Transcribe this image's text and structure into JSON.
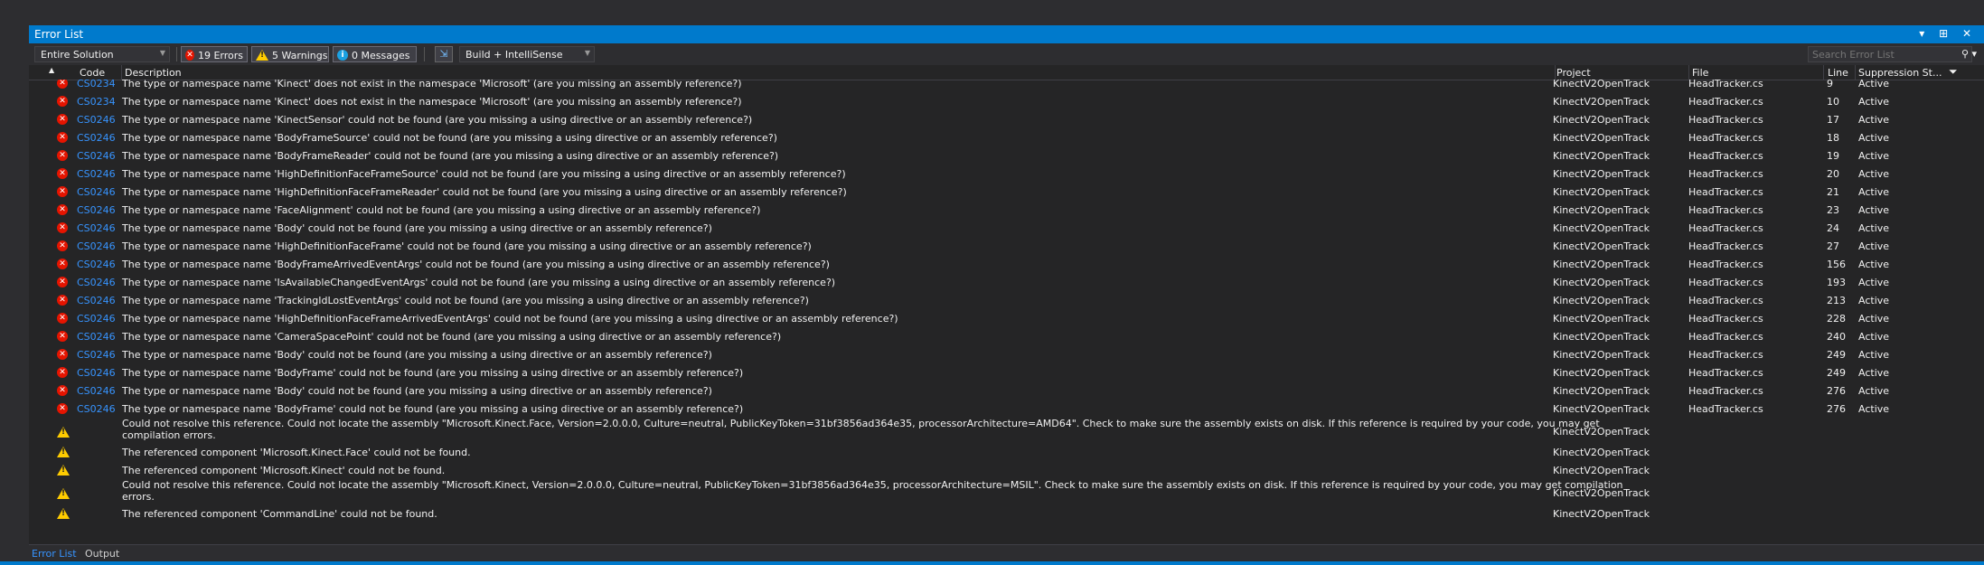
{
  "panel": {
    "title": "Error List",
    "window_buttons": "▾ ⊞ ✕"
  },
  "toolbar": {
    "scope": "Entire Solution",
    "errors": "19 Errors",
    "warnings": "5 Warnings",
    "messages": "0 Messages",
    "build_filter": "Build + IntelliSense",
    "search_placeholder": "Search Error List"
  },
  "columns": {
    "code": "Code",
    "description": "Description",
    "project": "Project",
    "file": "File",
    "line": "Line",
    "suppression": "Suppression St..."
  },
  "rows": [
    {
      "type": "error",
      "code": "CS0234",
      "desc": "The type or namespace name 'Kinect' does not exist in the namespace 'Microsoft' (are you missing an assembly reference?)",
      "project": "KinectV2OpenTrack",
      "file": "HeadTracker.cs",
      "line": "9",
      "state": "Active"
    },
    {
      "type": "error",
      "code": "CS0234",
      "desc": "The type or namespace name 'Kinect' does not exist in the namespace 'Microsoft' (are you missing an assembly reference?)",
      "project": "KinectV2OpenTrack",
      "file": "HeadTracker.cs",
      "line": "10",
      "state": "Active"
    },
    {
      "type": "error",
      "code": "CS0246",
      "desc": "The type or namespace name 'KinectSensor' could not be found (are you missing a using directive or an assembly reference?)",
      "project": "KinectV2OpenTrack",
      "file": "HeadTracker.cs",
      "line": "17",
      "state": "Active"
    },
    {
      "type": "error",
      "code": "CS0246",
      "desc": "The type or namespace name 'BodyFrameSource' could not be found (are you missing a using directive or an assembly reference?)",
      "project": "KinectV2OpenTrack",
      "file": "HeadTracker.cs",
      "line": "18",
      "state": "Active"
    },
    {
      "type": "error",
      "code": "CS0246",
      "desc": "The type or namespace name 'BodyFrameReader' could not be found (are you missing a using directive or an assembly reference?)",
      "project": "KinectV2OpenTrack",
      "file": "HeadTracker.cs",
      "line": "19",
      "state": "Active"
    },
    {
      "type": "error",
      "code": "CS0246",
      "desc": "The type or namespace name 'HighDefinitionFaceFrameSource' could not be found (are you missing a using directive or an assembly reference?)",
      "project": "KinectV2OpenTrack",
      "file": "HeadTracker.cs",
      "line": "20",
      "state": "Active"
    },
    {
      "type": "error",
      "code": "CS0246",
      "desc": "The type or namespace name 'HighDefinitionFaceFrameReader' could not be found (are you missing a using directive or an assembly reference?)",
      "project": "KinectV2OpenTrack",
      "file": "HeadTracker.cs",
      "line": "21",
      "state": "Active"
    },
    {
      "type": "error",
      "code": "CS0246",
      "desc": "The type or namespace name 'FaceAlignment' could not be found (are you missing a using directive or an assembly reference?)",
      "project": "KinectV2OpenTrack",
      "file": "HeadTracker.cs",
      "line": "23",
      "state": "Active"
    },
    {
      "type": "error",
      "code": "CS0246",
      "desc": "The type or namespace name 'Body' could not be found (are you missing a using directive or an assembly reference?)",
      "project": "KinectV2OpenTrack",
      "file": "HeadTracker.cs",
      "line": "24",
      "state": "Active"
    },
    {
      "type": "error",
      "code": "CS0246",
      "desc": "The type or namespace name 'HighDefinitionFaceFrame' could not be found (are you missing a using directive or an assembly reference?)",
      "project": "KinectV2OpenTrack",
      "file": "HeadTracker.cs",
      "line": "27",
      "state": "Active"
    },
    {
      "type": "error",
      "code": "CS0246",
      "desc": "The type or namespace name 'BodyFrameArrivedEventArgs' could not be found (are you missing a using directive or an assembly reference?)",
      "project": "KinectV2OpenTrack",
      "file": "HeadTracker.cs",
      "line": "156",
      "state": "Active"
    },
    {
      "type": "error",
      "code": "CS0246",
      "desc": "The type or namespace name 'IsAvailableChangedEventArgs' could not be found (are you missing a using directive or an assembly reference?)",
      "project": "KinectV2OpenTrack",
      "file": "HeadTracker.cs",
      "line": "193",
      "state": "Active"
    },
    {
      "type": "error",
      "code": "CS0246",
      "desc": "The type or namespace name 'TrackingIdLostEventArgs' could not be found (are you missing a using directive or an assembly reference?)",
      "project": "KinectV2OpenTrack",
      "file": "HeadTracker.cs",
      "line": "213",
      "state": "Active"
    },
    {
      "type": "error",
      "code": "CS0246",
      "desc": "The type or namespace name 'HighDefinitionFaceFrameArrivedEventArgs' could not be found (are you missing a using directive or an assembly reference?)",
      "project": "KinectV2OpenTrack",
      "file": "HeadTracker.cs",
      "line": "228",
      "state": "Active"
    },
    {
      "type": "error",
      "code": "CS0246",
      "desc": "The type or namespace name 'CameraSpacePoint' could not be found (are you missing a using directive or an assembly reference?)",
      "project": "KinectV2OpenTrack",
      "file": "HeadTracker.cs",
      "line": "240",
      "state": "Active"
    },
    {
      "type": "error",
      "code": "CS0246",
      "desc": "The type or namespace name 'Body' could not be found (are you missing a using directive or an assembly reference?)",
      "project": "KinectV2OpenTrack",
      "file": "HeadTracker.cs",
      "line": "249",
      "state": "Active"
    },
    {
      "type": "error",
      "code": "CS0246",
      "desc": "The type or namespace name 'BodyFrame' could not be found (are you missing a using directive or an assembly reference?)",
      "project": "KinectV2OpenTrack",
      "file": "HeadTracker.cs",
      "line": "249",
      "state": "Active"
    },
    {
      "type": "error",
      "code": "CS0246",
      "desc": "The type or namespace name 'Body' could not be found (are you missing a using directive or an assembly reference?)",
      "project": "KinectV2OpenTrack",
      "file": "HeadTracker.cs",
      "line": "276",
      "state": "Active"
    },
    {
      "type": "error",
      "code": "CS0246",
      "desc": "The type or namespace name 'BodyFrame' could not be found (are you missing a using directive or an assembly reference?)",
      "project": "KinectV2OpenTrack",
      "file": "HeadTracker.cs",
      "line": "276",
      "state": "Active"
    },
    {
      "type": "warning",
      "code": "",
      "desc": "Could not resolve this reference. Could not locate the assembly \"Microsoft.Kinect.Face, Version=2.0.0.0, Culture=neutral, PublicKeyToken=31bf3856ad364e35, processorArchitecture=AMD64\". Check to make sure the assembly exists on disk. If this reference is required by your code, you may get",
      "desc2": "compilation errors.",
      "project": "KinectV2OpenTrack",
      "file": "",
      "line": "",
      "state": ""
    },
    {
      "type": "warning",
      "code": "",
      "desc": "The referenced component 'Microsoft.Kinect.Face' could not be found.",
      "project": "KinectV2OpenTrack",
      "file": "",
      "line": "",
      "state": ""
    },
    {
      "type": "warning",
      "code": "",
      "desc": "The referenced component 'Microsoft.Kinect' could not be found.",
      "project": "KinectV2OpenTrack",
      "file": "",
      "line": "",
      "state": ""
    },
    {
      "type": "warning",
      "code": "",
      "desc": "Could not resolve this reference. Could not locate the assembly \"Microsoft.Kinect, Version=2.0.0.0, Culture=neutral, PublicKeyToken=31bf3856ad364e35, processorArchitecture=MSIL\". Check to make sure the assembly exists on disk. If this reference is required by your code, you may get compilation",
      "desc2": "errors.",
      "project": "KinectV2OpenTrack",
      "file": "",
      "line": "",
      "state": ""
    },
    {
      "type": "warning",
      "code": "",
      "desc": "The referenced component 'CommandLine' could not be found.",
      "project": "KinectV2OpenTrack",
      "file": "",
      "line": "",
      "state": ""
    }
  ],
  "bottom_tabs": [
    "Error List",
    "Output"
  ]
}
